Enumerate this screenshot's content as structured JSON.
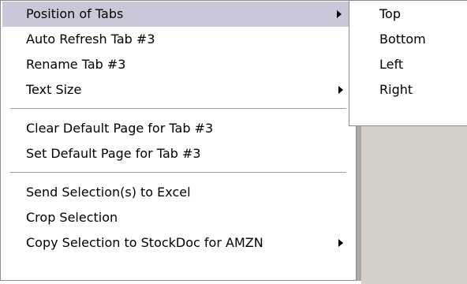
{
  "main_menu": {
    "items": [
      {
        "label": "Position of Tabs",
        "has_submenu": true,
        "highlighted": true
      },
      {
        "label": "Auto Refresh Tab #3"
      },
      {
        "label": "Rename Tab #3"
      },
      {
        "label": "Text Size",
        "has_submenu": true
      },
      {
        "label": "Clear Default Page for Tab #3"
      },
      {
        "label": "Set Default Page for Tab #3"
      },
      {
        "label": "Send Selection(s) to Excel"
      },
      {
        "label": "Crop Selection"
      },
      {
        "label": "Copy Selection to StockDoc for AMZN",
        "has_submenu": true
      }
    ]
  },
  "submenu": {
    "items": [
      {
        "label": "Top"
      },
      {
        "label": "Bottom"
      },
      {
        "label": "Left"
      },
      {
        "label": "Right"
      }
    ]
  },
  "colors": {
    "highlight": "#cac8d8",
    "menu_background": "#ffffff",
    "border": "#8c8c8c",
    "separator": "#a0a0a0",
    "desktop": "#d4d0c8"
  },
  "icons": {
    "submenu_arrow": "triangle-right-icon"
  }
}
